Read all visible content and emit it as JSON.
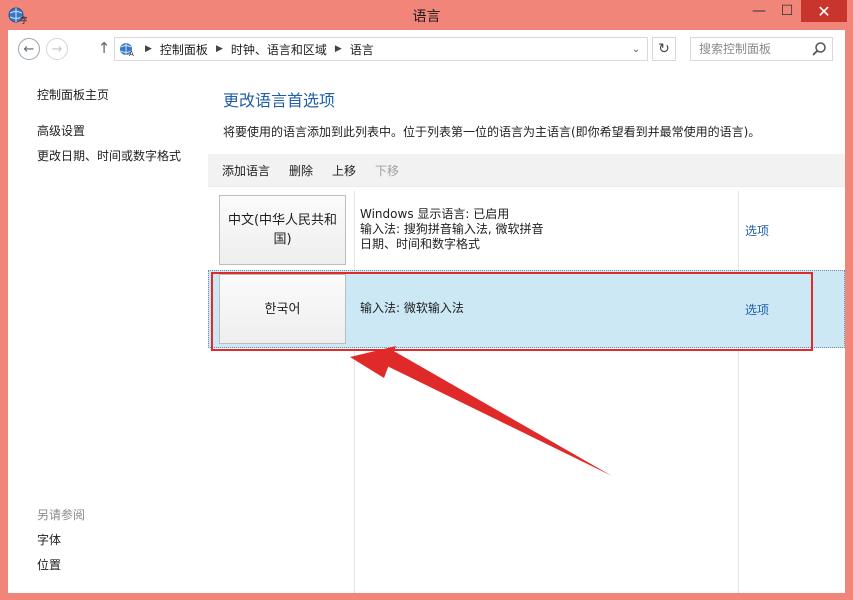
{
  "window": {
    "title": "语言",
    "controls": {
      "minimize": "—",
      "maximize": "☐",
      "close": "✕"
    }
  },
  "address": {
    "path": [
      "控制面板",
      "时钟、语言和区域",
      "语言"
    ],
    "search_placeholder": "搜索控制面板"
  },
  "sidebar": {
    "home": "控制面板主页",
    "links": [
      "高级设置",
      "更改日期、时间或数字格式"
    ],
    "see_also_title": "另请参阅",
    "see_also": [
      "字体",
      "位置"
    ]
  },
  "main": {
    "title": "更改语言首选项",
    "description": "将要使用的语言添加到此列表中。位于列表第一位的语言为主语言(即你希望看到并最常使用的语言)。",
    "toolbar": {
      "add": "添加语言",
      "remove": "删除",
      "up": "上移",
      "down": "下移"
    },
    "languages": [
      {
        "name": "中文(中华人民共和国)",
        "info": [
          "Windows 显示语言: 已启用",
          "输入法: 搜狗拼音输入法, 微软拼音",
          "日期、时间和数字格式"
        ],
        "options": "选项",
        "selected": false
      },
      {
        "name": "한국어",
        "info": [
          "输入法: 微软输入法"
        ],
        "options": "选项",
        "selected": true
      }
    ]
  },
  "annotation": {
    "color": "#e02a2a"
  }
}
